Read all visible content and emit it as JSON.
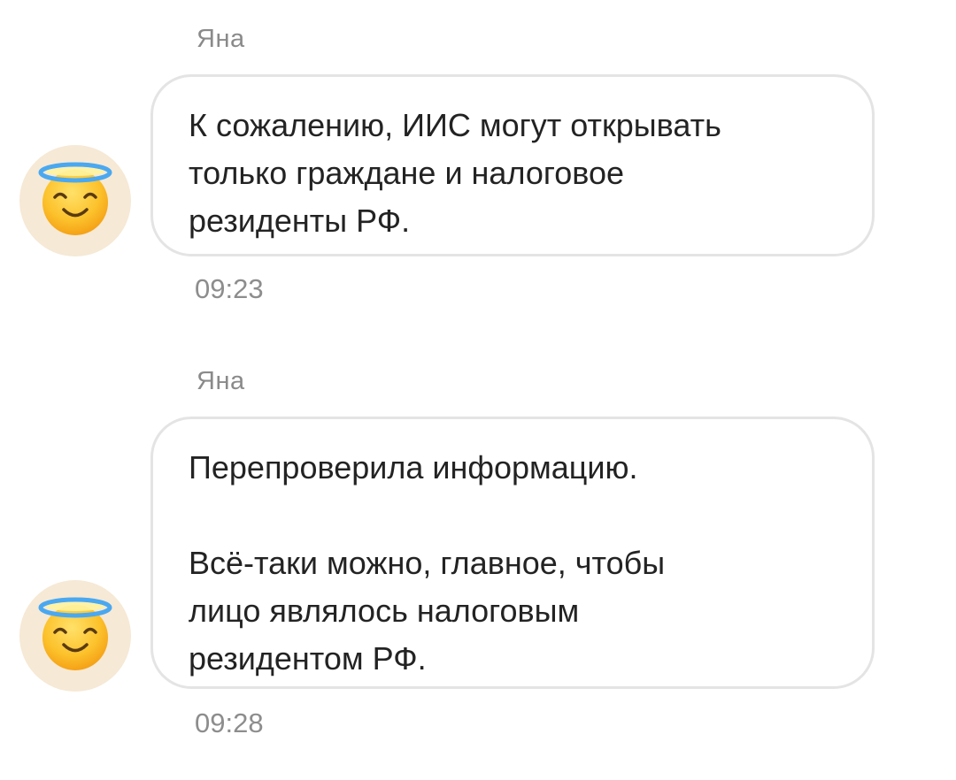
{
  "messages": [
    {
      "sender": "Яна",
      "avatar_icon": "smiling-face-with-halo-icon",
      "paragraphs": [
        "К сожалению, ИИС могут открывать\nтолько граждане и налоговое\nрезиденты РФ."
      ],
      "time": "09:23"
    },
    {
      "sender": "Яна",
      "avatar_icon": "smiling-face-with-halo-icon",
      "paragraphs": [
        "Перепроверила информацию.",
        "Всё-таки можно, главное, чтобы\nлицо являлось налоговым\nрезидентом РФ."
      ],
      "time": "09:28"
    }
  ],
  "colors": {
    "avatar_bg": "#f6e9d5",
    "bubble_border": "#e4e4e4",
    "meta_text": "#8a8a8a",
    "halo": "#4aa8f0",
    "face": "#fbbf24"
  }
}
